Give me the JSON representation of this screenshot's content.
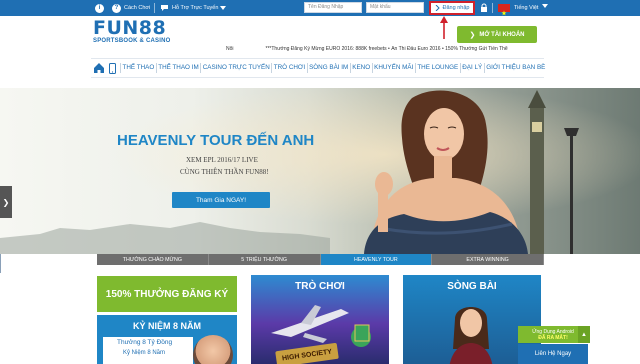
{
  "topbar": {
    "info_icon": "i",
    "help_icon": "?",
    "help_label": "Cách Chơi",
    "support_label": "Hỗ Trợ Trực Tuyến",
    "username_placeholder": "Tên Đăng Nhập",
    "password_placeholder": "Mật khẩu",
    "login_label": "Đăng nhập",
    "language_label": "Tiếng Việt"
  },
  "brand": {
    "logo_text": "FUN88",
    "logo_sub": "SPORTSBOOK & CASINO"
  },
  "register_label": "MỞ TÀI KHOẢN",
  "ticker": {
    "prefix": "Nổi",
    "text": "***Thưởng Đăng Ký Mừng EURO 2016: 888K freebets • Ăn Thi Đấu Euro 2016 • 150% Thưởng Gửi Tiền Thể"
  },
  "nav": {
    "items": [
      "THỂ THAO",
      "THỂ THAO IM",
      "CASINO TRỰC TUYẾN",
      "TRÒ CHƠI",
      "SÒNG BÀI IM",
      "KENO",
      "KHUYẾN MÃI",
      "THE LOUNGE",
      "ĐẠI LÝ",
      "GIỚI THIỆU BẠN BÈ"
    ]
  },
  "hero": {
    "title": "HEAVENLY TOUR ĐẾN ANH",
    "line1": "XEM EPL 2016/17 LIVE",
    "line2": "CÙNG THIÊN THẦN FUN88!",
    "cta": "Tham Gia NGAY!"
  },
  "slider_tabs": [
    {
      "label": "THƯỞNG CHÀO MỪNG",
      "active": false
    },
    {
      "label": "5 TRIỆU THƯỞNG",
      "active": false
    },
    {
      "label": "HEAVENLY TOUR",
      "active": true
    },
    {
      "label": "EXTRA WINNING",
      "active": false
    }
  ],
  "tiles": {
    "t1_top": "150% THƯỞNG ĐĂNG KÝ",
    "t1_title": "KỶ NIỆM 8 NĂM",
    "t1_line1": "Thưởng 8 Tỷ Đồng",
    "t1_line2": "Kỷ Niệm 8 Năm",
    "t2_title": "TRÒ CHƠI",
    "t2_sign": "HIGH SOCIETY",
    "t3_title": "SÒNG BÀI"
  },
  "chat": {
    "app_line1": "Ứng Dụng Android",
    "app_line2": "ĐÃ RA MẮT!",
    "contact": "Liên Hệ Ngay"
  },
  "colors": {
    "brand_blue": "#1f6fb3",
    "accent_blue": "#1f86c6",
    "green": "#7fba2f",
    "alert_red": "#d0212b"
  }
}
